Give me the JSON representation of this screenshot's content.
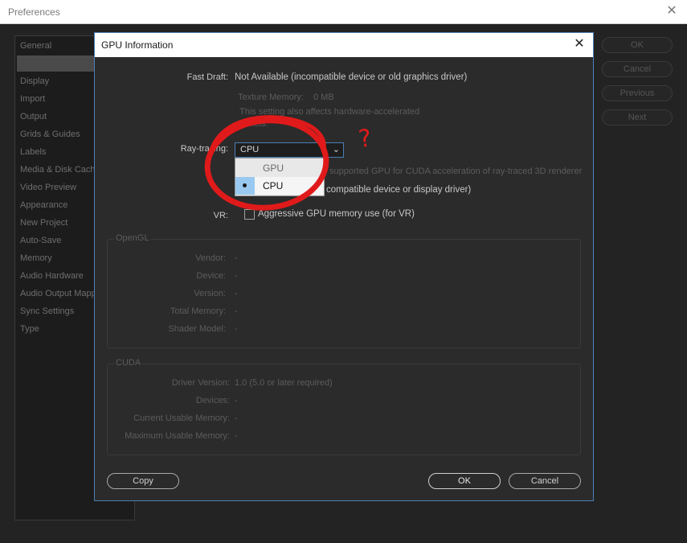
{
  "preferences": {
    "title": "Preferences",
    "sidebar": [
      "General",
      "",
      "Display",
      "Import",
      "Output",
      "Grids & Guides",
      "Labels",
      "Media & Disk Cache",
      "Video Preview",
      "Appearance",
      "New Project",
      "Auto-Save",
      "Memory",
      "Audio Hardware",
      "Audio Output Mapping",
      "Sync Settings",
      "Type"
    ],
    "buttons": {
      "ok": "OK",
      "cancel": "Cancel",
      "previous": "Previous",
      "next": "Next"
    }
  },
  "dialog": {
    "title": "GPU Information",
    "fast_draft": {
      "label": "Fast Draft:",
      "value": "Not Available (incompatible device or old graphics driver)"
    },
    "texture_memory": {
      "label": "Texture Memory:",
      "value": "0 MB"
    },
    "fast_draft_note_line1": "This setting also affects hardware-accelerated",
    "fast_draft_note_line2": "panels.",
    "ray_tracing": {
      "label": "Ray-tracing:",
      "selected": "CPU",
      "options": [
        "GPU",
        "CPU"
      ],
      "note": "supported GPU for CUDA acceleration of ray-traced 3D renderer",
      "availability": "compatible device or display driver)"
    },
    "vr": {
      "label": "VR:",
      "checkbox_label": "Aggressive GPU memory use (for VR)",
      "checked": false
    },
    "opengl": {
      "title": "OpenGL",
      "fields": [
        {
          "label": "Vendor:",
          "value": "-"
        },
        {
          "label": "Device:",
          "value": "-"
        },
        {
          "label": "Version:",
          "value": "-"
        },
        {
          "label": "Total Memory:",
          "value": "-"
        },
        {
          "label": "Shader Model:",
          "value": "-"
        }
      ]
    },
    "cuda": {
      "title": "CUDA",
      "fields": [
        {
          "label": "Driver Version:",
          "value": "1.0 (5.0 or later required)"
        },
        {
          "label": "Devices:",
          "value": "-"
        },
        {
          "label": "Current Usable Memory:",
          "value": "-"
        },
        {
          "label": "Maximum Usable Memory:",
          "value": "-"
        }
      ]
    },
    "buttons": {
      "copy": "Copy",
      "ok": "OK",
      "cancel": "Cancel"
    }
  },
  "annotation": {
    "mark": "?",
    "color": "#e01a1a"
  }
}
